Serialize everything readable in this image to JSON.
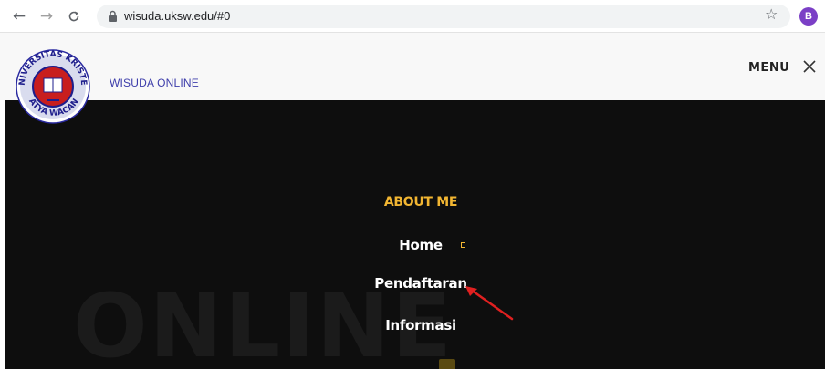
{
  "browser": {
    "url": "wisuda.uksw.edu/#0",
    "back_icon": "arrow-left-icon",
    "forward_icon": "arrow-right-icon",
    "reload_icon": "reload-icon",
    "lock_icon": "lock-icon",
    "star_icon": "star-icon",
    "profile_initial": "B",
    "profile_color": "#7b3fc6"
  },
  "header": {
    "logo_text": "UNIVERSITAS KRISTEN SATYA WACANA",
    "site_name": "WISUDA ONLINE",
    "menu_label": "MENU",
    "close_icon": "close-icon"
  },
  "overlay": {
    "background_word": "ONLINE",
    "heading": "ABOUT ME",
    "items": [
      {
        "label": "Home"
      },
      {
        "label": "Pendaftaran"
      },
      {
        "label": "Informasi"
      }
    ]
  },
  "colors": {
    "accent": "#f2b632",
    "overlay_bg": "#0e0e0e",
    "site_name": "#3c3caa",
    "annotation_arrow": "#e02020"
  }
}
